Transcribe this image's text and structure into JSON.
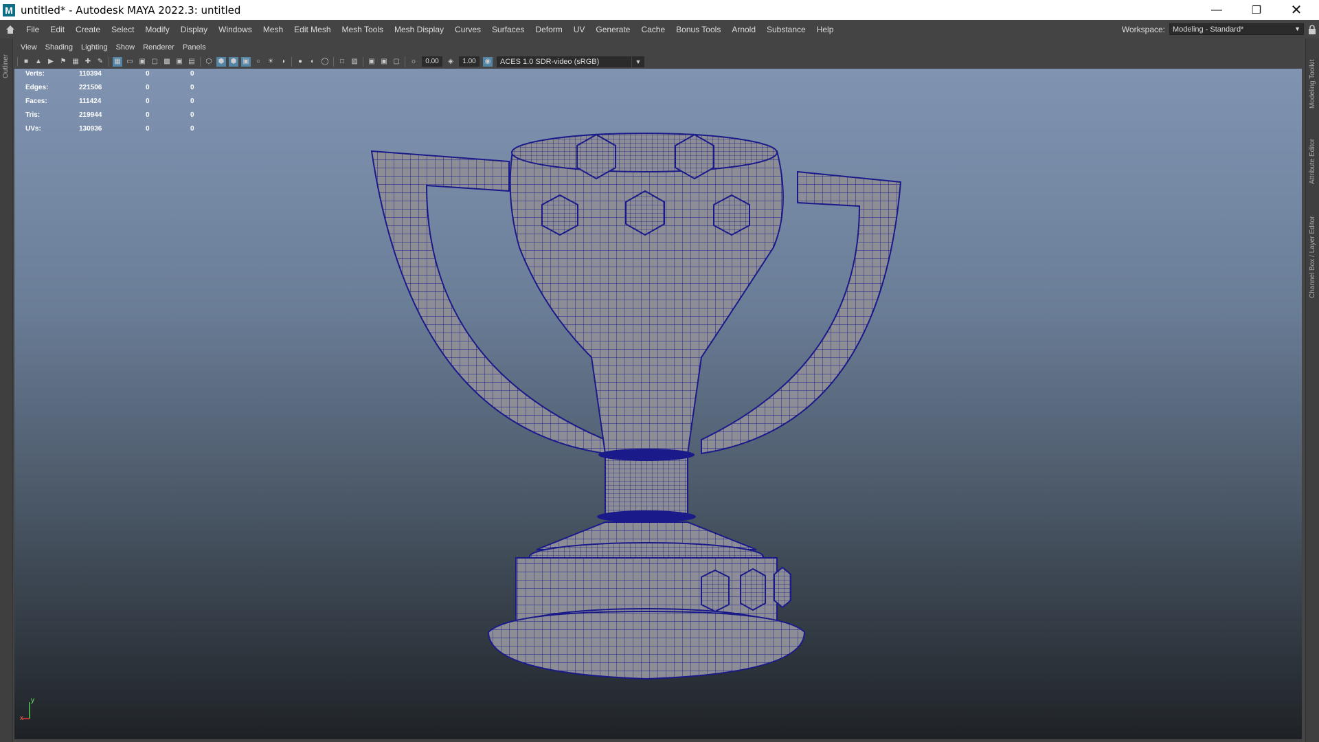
{
  "window": {
    "title": "untitled* - Autodesk MAYA 2022.3: untitled",
    "logo": "M"
  },
  "menu": [
    "File",
    "Edit",
    "Create",
    "Select",
    "Modify",
    "Display",
    "Windows",
    "Mesh",
    "Edit Mesh",
    "Mesh Tools",
    "Mesh Display",
    "Curves",
    "Surfaces",
    "Deform",
    "UV",
    "Generate",
    "Cache",
    "Bonus Tools",
    "Arnold",
    "Substance",
    "Help"
  ],
  "workspace": {
    "label": "Workspace:",
    "value": "Modeling - Standard*"
  },
  "left_tabs": {
    "outliner": "Outliner"
  },
  "right_tabs": {
    "modeling_toolkit": "Modeling Toolkit",
    "attribute_editor": "Attribute Editor",
    "channel_box": "Channel Box / Layer Editor"
  },
  "panel_menu": [
    "View",
    "Shading",
    "Lighting",
    "Show",
    "Renderer",
    "Panels"
  ],
  "toolbar": {
    "field1": "0.00",
    "field2": "1.00",
    "color_space": "ACES 1.0 SDR-video (sRGB)"
  },
  "hud": [
    {
      "label": "Verts:",
      "v1": "110394",
      "v2": "0",
      "v3": "0"
    },
    {
      "label": "Edges:",
      "v1": "221506",
      "v2": "0",
      "v3": "0"
    },
    {
      "label": "Faces:",
      "v1": "111424",
      "v2": "0",
      "v3": "0"
    },
    {
      "label": "Tris:",
      "v1": "219944",
      "v2": "0",
      "v3": "0"
    },
    {
      "label": "UVs:",
      "v1": "130936",
      "v2": "0",
      "v3": "0"
    }
  ],
  "axis": {
    "x": "x",
    "y": "y"
  },
  "colors": {
    "wire": "#1a1a8a",
    "surface": "#8d8d95",
    "accent": "#5285a6"
  }
}
